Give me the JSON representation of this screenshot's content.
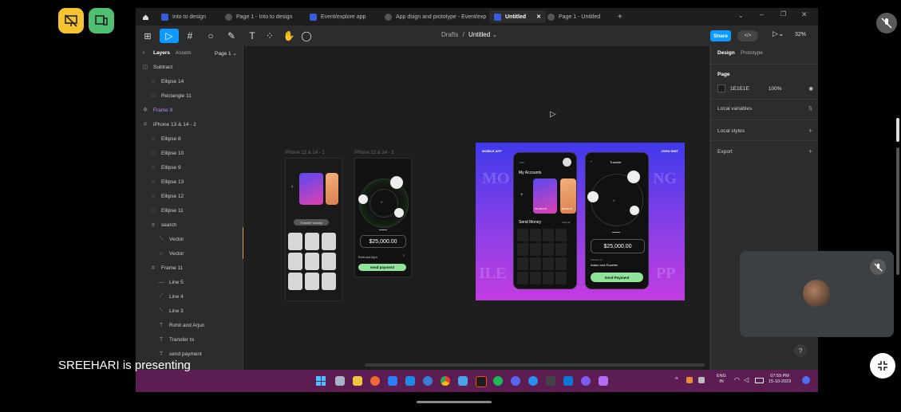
{
  "meet": {
    "presenting_text": "SREEHARI is presenting"
  },
  "tabs": [
    {
      "label": "Into to design",
      "active": false
    },
    {
      "label": "Page 1 - Into to design",
      "active": false
    },
    {
      "label": "Event/explore app",
      "active": false
    },
    {
      "label": "App dsign and prototype - Event/exp",
      "active": false
    },
    {
      "label": "Untitled",
      "active": true
    },
    {
      "label": "Page 1 - Untitled",
      "active": false
    }
  ],
  "toolbar": {
    "breadcrumb_root": "Drafts",
    "breadcrumb_sep": "/",
    "file_name": "Untitled",
    "share_label": "Share",
    "zoom": "32%"
  },
  "left_panel": {
    "tab_layers": "Layers",
    "tab_assets": "Assets",
    "page_selector": "Page 1",
    "layers": [
      {
        "name": "Subtract",
        "icon": "◫",
        "indent": 0
      },
      {
        "name": "Ellipse 14",
        "icon": "○",
        "indent": 1
      },
      {
        "name": "Rectangle 11",
        "icon": "□",
        "indent": 1
      },
      {
        "name": "Frame 9",
        "icon": "✥",
        "indent": 0,
        "highlight": true
      },
      {
        "name": "iPhone 13 & 14 - 2",
        "icon": "#",
        "indent": 0
      },
      {
        "name": "Ellipse 8",
        "icon": "○",
        "indent": 1
      },
      {
        "name": "Ellipse 10",
        "icon": "○",
        "indent": 1
      },
      {
        "name": "Ellipse 9",
        "icon": "○",
        "indent": 1
      },
      {
        "name": "Ellipse 13",
        "icon": "○",
        "indent": 1
      },
      {
        "name": "Ellipse 12",
        "icon": "○",
        "indent": 1
      },
      {
        "name": "Ellipse 11",
        "icon": "○",
        "indent": 1
      },
      {
        "name": "search",
        "icon": "#",
        "indent": 1
      },
      {
        "name": "Vector",
        "icon": "⟍",
        "indent": 2
      },
      {
        "name": "Vector",
        "icon": "○",
        "indent": 2
      },
      {
        "name": "Frame 11",
        "icon": "#",
        "indent": 1
      },
      {
        "name": "Line 5",
        "icon": "—",
        "indent": 2
      },
      {
        "name": "Line 4",
        "icon": "⟋",
        "indent": 2
      },
      {
        "name": "Line 3",
        "icon": "⟍",
        "indent": 2
      },
      {
        "name": "Rohit and Arjun",
        "icon": "T",
        "indent": 2
      },
      {
        "name": "Transfer to",
        "icon": "T",
        "indent": 2
      },
      {
        "name": "send payment",
        "icon": "T",
        "indent": 2
      }
    ]
  },
  "canvas": {
    "frame1_label": "iPhone 13 & 14 - 1",
    "frame2_label": "iPhone 13 & 14 - 2",
    "frame1_button": "Transfer money",
    "frame2_amount": "$25,000.00",
    "frame2_name": "Rohit and Arjun",
    "frame2_button": "send payment",
    "poster": {
      "top_left": "MOBILE APP",
      "top_right": "JOHN SMIT",
      "bg_word_top_left": "MO",
      "bg_word_top_right": "NG",
      "bg_word_bottom_left": "ILE",
      "bg_word_bottom_right": "PP",
      "phone1_title": "My Accounts",
      "phone1_section": "Send Money",
      "phone1_view_all": "View all",
      "phone1_card_amount": "$12,800.00",
      "phone1_card2_amount": "$8,800.00",
      "phone2_header": "Transfer",
      "phone2_amount": "$25,000.00",
      "phone2_sub": "Transfer to",
      "phone2_name": "Adam and Rosefrin",
      "phone2_button": "Send Payment"
    }
  },
  "right_panel": {
    "tab_design": "Design",
    "tab_prototype": "Prototype",
    "page_title": "Page",
    "page_color": "1E1E1E",
    "page_opacity": "100%",
    "local_variables": "Local variables",
    "local_styles": "Local styles",
    "export": "Export"
  },
  "taskbar": {
    "lang_top": "ENG",
    "lang_bottom": "IN",
    "time": "07:59 PM",
    "date": "15-10-2023"
  },
  "colors": {
    "figma_blue": "#0d99ff",
    "taskbar": "#5b1d52",
    "meet_yellow": "#f6c331",
    "meet_green": "#4fbf71",
    "accent_green": "#8fe39a"
  }
}
